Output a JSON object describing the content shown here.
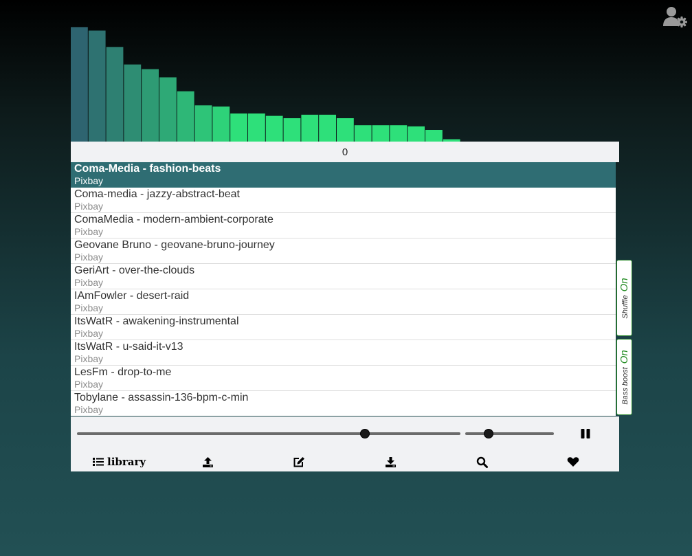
{
  "visualizer": {
    "bar_levels": [
      0.98,
      0.95,
      0.81,
      0.66,
      0.62,
      0.55,
      0.43,
      0.31,
      0.3,
      0.24,
      0.24,
      0.22,
      0.2,
      0.23,
      0.23,
      0.2,
      0.14,
      0.14,
      0.14,
      0.13,
      0.1,
      0.02,
      0,
      0,
      0,
      0,
      0,
      0,
      0,
      0,
      0
    ],
    "colors": {
      "low": "#2e6470",
      "high": "#2ee07a"
    }
  },
  "counter": "0",
  "playlist": [
    {
      "title": "Coma-Media - fashion-beats",
      "source": "Pixbay",
      "active": true
    },
    {
      "title": "Coma-media - jazzy-abstract-beat",
      "source": "Pixbay",
      "active": false
    },
    {
      "title": "ComaMedia - modern-ambient-corporate",
      "source": "Pixbay",
      "active": false
    },
    {
      "title": "Geovane Bruno - geovane-bruno-journey",
      "source": "Pixbay",
      "active": false
    },
    {
      "title": "GeriArt - over-the-clouds",
      "source": "Pixbay",
      "active": false
    },
    {
      "title": "IAmFowler - desert-raid",
      "source": "Pixbay",
      "active": false
    },
    {
      "title": "ItsWatR - awakening-instrumental",
      "source": "Pixbay",
      "active": false
    },
    {
      "title": "ItsWatR - u-said-it-v13",
      "source": "Pixbay",
      "active": false
    },
    {
      "title": "LesFm - drop-to-me",
      "source": "Pixbay",
      "active": false
    },
    {
      "title": "Tobylane - assassin-136-bpm-c-min",
      "source": "Pixbay",
      "active": false
    }
  ],
  "toggles": {
    "shuffle": {
      "label": "Shuffle",
      "state": "On"
    },
    "bass_boost": {
      "label": "Bass boost",
      "state": "On"
    }
  },
  "player": {
    "progress_fraction": 0.75,
    "volume_fraction": 0.26,
    "play_state_icon": "pause-icon"
  },
  "nav": {
    "library_label": "library",
    "items": [
      "list-icon",
      "upload-icon",
      "edit-icon",
      "download-icon",
      "search-icon",
      "heart-icon"
    ]
  },
  "header": {
    "user_icon": "user-gear-icon"
  }
}
